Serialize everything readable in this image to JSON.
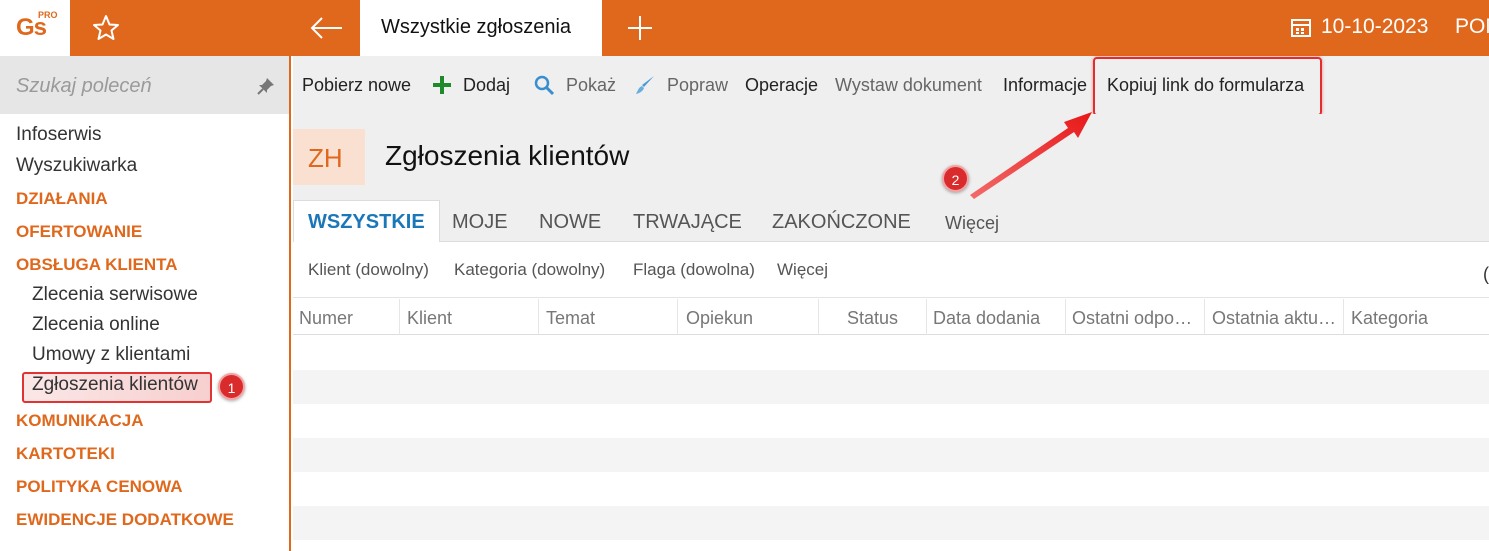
{
  "topbar": {
    "logo_main": "Gs",
    "logo_sup": "PRO",
    "active_tab": "Wszystkie zgłoszenia",
    "date": "10-10-2023",
    "user_fragment": "POM",
    "accent": "#e0681d"
  },
  "sidebar": {
    "search_placeholder": "Szukaj poleceń",
    "items": [
      {
        "label": "Infoserwis",
        "kind": "item"
      },
      {
        "label": "Wyszukiwarka",
        "kind": "item"
      },
      {
        "label": "DZIAŁANIA",
        "kind": "section"
      },
      {
        "label": "OFERTOWANIE",
        "kind": "section"
      },
      {
        "label": "OBSŁUGA KLIENTA",
        "kind": "section"
      },
      {
        "label": "Zlecenia serwisowe",
        "kind": "sub"
      },
      {
        "label": "Zlecenia online",
        "kind": "sub"
      },
      {
        "label": "Umowy z klientami",
        "kind": "sub"
      },
      {
        "label": "Zgłoszenia klientów",
        "kind": "sub"
      },
      {
        "label": "KOMUNIKACJA",
        "kind": "section"
      },
      {
        "label": "KARTOTEKI",
        "kind": "section"
      },
      {
        "label": "POLITYKA CENOWA",
        "kind": "section"
      },
      {
        "label": "EWIDENCJE DODATKOWE",
        "kind": "section"
      }
    ],
    "callout_1": "1"
  },
  "toolbar": {
    "fetch_new": "Pobierz nowe",
    "add": "Dodaj",
    "show": "Pokaż",
    "edit": "Popraw",
    "operations": "Operacje",
    "issue_document": "Wystaw dokument",
    "information": "Informacje",
    "copy_link": "Kopiuj link do formularza"
  },
  "header": {
    "badge": "ZH",
    "title": "Zgłoszenia klientów",
    "callout_2": "2"
  },
  "tabs": [
    "WSZYSTKIE",
    "MOJE",
    "NOWE",
    "TRWAJĄCE",
    "ZAKOŃCZONE",
    "Więcej"
  ],
  "filters": [
    "Klient (dowolny)",
    "Kategoria (dowolny)",
    "Flaga (dowolna)",
    "Więcej"
  ],
  "filters_fragment": "(",
  "grid": {
    "columns": [
      "Numer",
      "Klient",
      "Temat",
      "Opiekun",
      "Status",
      "Data dodania",
      "Ostatni odpo…",
      "Ostatnia aktu…",
      "Kategoria"
    ],
    "rows": []
  }
}
